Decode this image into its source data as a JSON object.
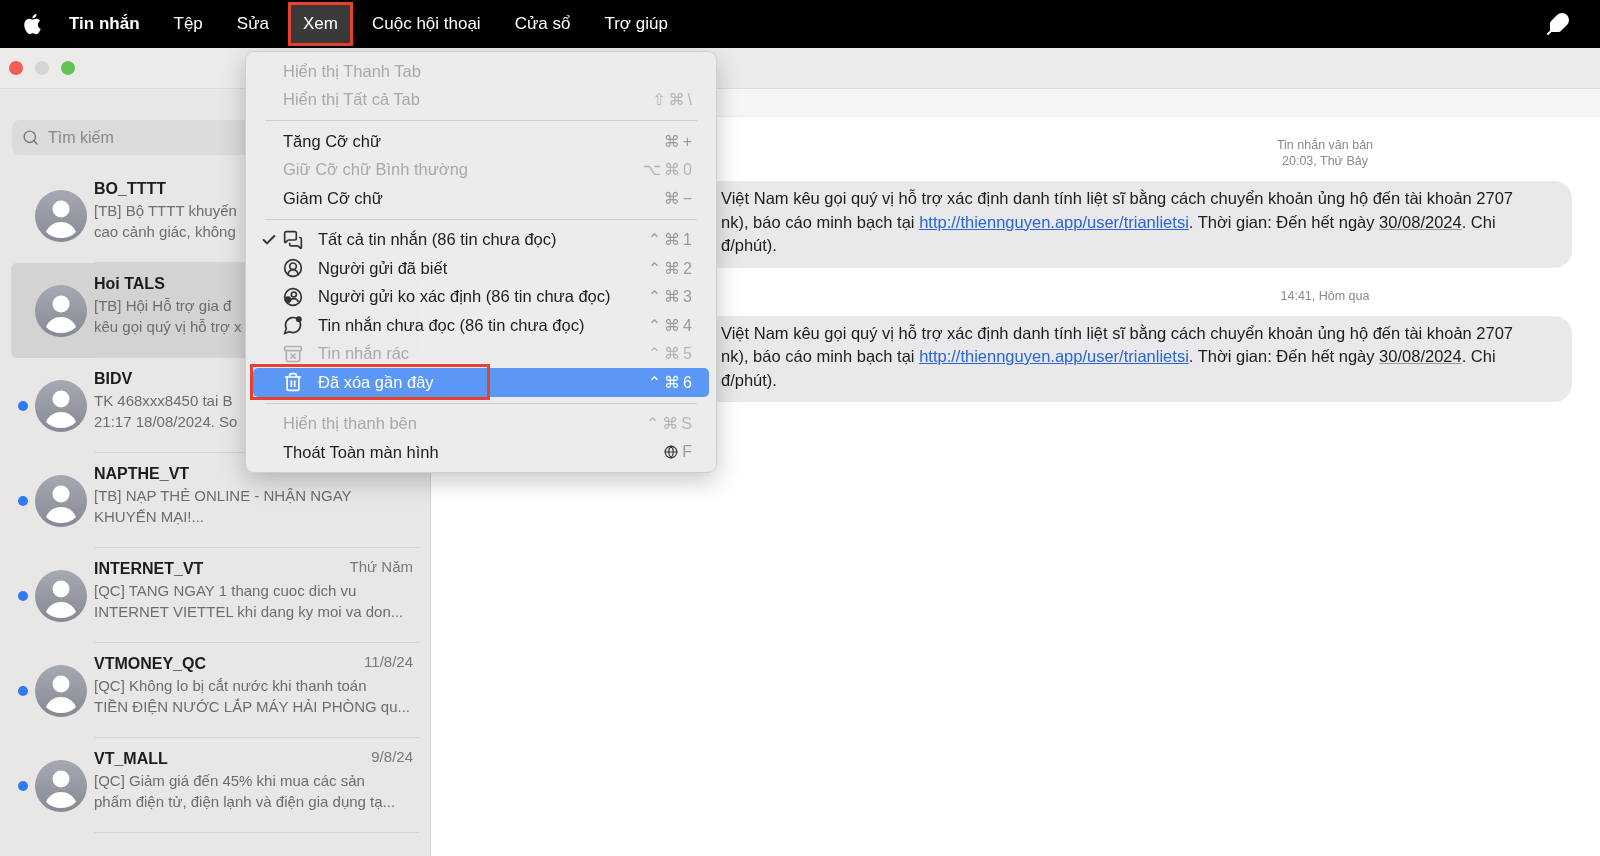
{
  "menubar": {
    "items": [
      {
        "label": "Tin nhắn",
        "kind": "app",
        "selected": false,
        "annotated": false
      },
      {
        "label": "Tệp",
        "kind": "menu",
        "selected": false,
        "annotated": false
      },
      {
        "label": "Sửa",
        "kind": "menu",
        "selected": false,
        "annotated": false
      },
      {
        "label": "Xem",
        "kind": "menu",
        "selected": true,
        "annotated": true
      },
      {
        "label": "Cuộc hội thoại",
        "kind": "menu",
        "selected": false,
        "annotated": false
      },
      {
        "label": "Cửa sổ",
        "kind": "menu",
        "selected": false,
        "annotated": false
      },
      {
        "label": "Trợ giúp",
        "kind": "menu",
        "selected": false,
        "annotated": false
      }
    ]
  },
  "sidebar": {
    "search": {
      "placeholder": "Tìm kiếm"
    },
    "conversations": [
      {
        "name": "BO_TTTT",
        "preview": [
          "[TB] Bộ TTTT khuyến",
          "cao cảnh giác, không"
        ],
        "unread": false,
        "selected": false
      },
      {
        "name": "Hoi TALS",
        "preview": [
          "[TB] Hội Hỗ trợ gia đ",
          "kêu gọi quý vị hỗ trợ x"
        ],
        "unread": false,
        "selected": true
      },
      {
        "name": "BIDV",
        "preview": [
          "TK 468xxx8450 tai B",
          "21:17 18/08/2024. So"
        ],
        "unread": true,
        "selected": false
      },
      {
        "name": "NAPTHE_VT",
        "preview": [
          "[TB] NẠP THẺ ONLINE - NHẬN NGAY",
          "KHUYẾN MẠI!..."
        ],
        "unread": true,
        "selected": false
      },
      {
        "name": "INTERNET_VT",
        "date": "Thứ Năm",
        "preview": [
          "[QC] TANG NGAY 1 thang cuoc dich vu",
          "INTERNET VIETTEL khi dang ky moi va don..."
        ],
        "unread": true,
        "selected": false
      },
      {
        "name": "VTMONEY_QC",
        "date": "11/8/24",
        "preview": [
          "[QC] Không lo bị cắt nước khi thanh toán",
          "TIỀN ĐIỆN NƯỚC LẮP MÁY HẢI PHÒNG qu..."
        ],
        "unread": true,
        "selected": false
      },
      {
        "name": "VT_MALL",
        "date": "9/8/24",
        "preview": [
          "[QC] Giảm giá đến 45% khi mua các sản",
          "phẩm điện tử, điện lạnh và điện gia dụng tạ..."
        ],
        "unread": true,
        "selected": false
      }
    ]
  },
  "chat": {
    "groups": [
      {
        "stamp": [
          "Tin nhắn văn bản",
          "20:03, Thứ Bảy"
        ],
        "lines": [
          [
            {
              "kind": "text",
              "text": "Việt Nam kêu gọi quý vị hỗ trợ xác định danh tính liệt sĩ bằng cách chuyển khoản ủng hộ đến tài khoản 2707"
            }
          ],
          [
            {
              "kind": "text",
              "text": "nk), báo cáo minh bạch tại "
            },
            {
              "kind": "link",
              "text": "http://thiennguyen.app/user/trianlietsi"
            },
            {
              "kind": "text",
              "text": ". Thời gian: Đến hết ngày "
            },
            {
              "kind": "date",
              "text": "30/08/2024"
            },
            {
              "kind": "text",
              "text": ". Chi"
            }
          ],
          [
            {
              "kind": "text",
              "text": "đ/phút)."
            }
          ]
        ]
      },
      {
        "stamp": [
          "14:41, Hôm qua"
        ],
        "lines": [
          [
            {
              "kind": "text",
              "text": "Việt Nam kêu gọi quý vị hỗ trợ xác định danh tính liệt sĩ bằng cách chuyển khoản ủng hộ đến tài khoản 2707"
            }
          ],
          [
            {
              "kind": "text",
              "text": "nk), báo cáo minh bạch tại "
            },
            {
              "kind": "link",
              "text": "http://thiennguyen.app/user/trianlietsi"
            },
            {
              "kind": "text",
              "text": ". Thời gian: Đến hết ngày "
            },
            {
              "kind": "date",
              "text": "30/08/2024"
            },
            {
              "kind": "text",
              "text": ". Chi"
            }
          ],
          [
            {
              "kind": "text",
              "text": "đ/phút)."
            }
          ]
        ]
      }
    ]
  },
  "menu": {
    "sections": [
      [
        {
          "label": "Hiển thị Thanh Tab",
          "disabled": true,
          "checked": false,
          "selected": false,
          "annotated": false
        },
        {
          "label": "Hiển thị Tất cả Tab",
          "shortcut": "⇧⌘\\",
          "disabled": true,
          "checked": false,
          "selected": false,
          "annotated": false
        }
      ],
      [
        {
          "label": "Tăng Cỡ chữ",
          "shortcut": "⌘+",
          "disabled": false,
          "checked": false,
          "selected": false,
          "annotated": false
        },
        {
          "label": "Giữ Cỡ chữ Bình thường",
          "shortcut": "⌥⌘0",
          "disabled": true,
          "checked": false,
          "selected": false,
          "annotated": false
        },
        {
          "label": "Giảm Cỡ chữ",
          "shortcut": "⌘−",
          "disabled": false,
          "checked": false,
          "selected": false,
          "annotated": false
        }
      ],
      [
        {
          "label": "Tất cả tin nhắn (86 tin chưa đọc)",
          "kind": "chats",
          "shortcut": "⌃⌘1",
          "disabled": false,
          "checked": true,
          "selected": false,
          "annotated": false
        },
        {
          "label": "Người gửi đã biết",
          "kind": "person",
          "shortcut": "⌃⌘2",
          "disabled": false,
          "checked": false,
          "selected": false,
          "annotated": false
        },
        {
          "label": "Người gửi ko xác định (86 tin chưa đọc)",
          "kind": "unknown",
          "shortcut": "⌃⌘3",
          "disabled": false,
          "checked": false,
          "selected": false,
          "annotated": false
        },
        {
          "label": "Tin nhắn chưa đọc (86 tin chưa đọc)",
          "kind": "unread",
          "shortcut": "⌃⌘4",
          "disabled": false,
          "checked": false,
          "selected": false,
          "annotated": false
        },
        {
          "label": "Tin nhắn rác",
          "kind": "junk",
          "shortcut": "⌃⌘5",
          "disabled": true,
          "checked": false,
          "selected": false,
          "annotated": false
        },
        {
          "label": "Đã xóa gần đây",
          "kind": "trash",
          "shortcut": "⌃⌘6",
          "disabled": false,
          "checked": false,
          "selected": true,
          "annotated": true
        }
      ],
      [
        {
          "label": "Hiển thị thanh bên",
          "shortcut": "⌃⌘S",
          "disabled": true,
          "checked": false,
          "selected": false,
          "annotated": false
        },
        {
          "label": "Thoát Toàn màn hình",
          "shortcut": "F",
          "fn_key": true,
          "disabled": false,
          "checked": false,
          "selected": false,
          "annotated": false
        }
      ]
    ]
  }
}
